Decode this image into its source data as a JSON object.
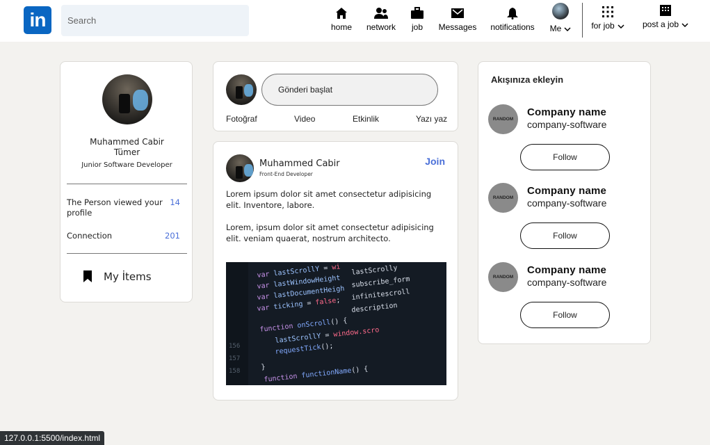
{
  "nav": {
    "logo_text": "in",
    "search_placeholder": "Search",
    "items": [
      {
        "label": "home",
        "icon": "home-icon"
      },
      {
        "label": "network",
        "icon": "people-icon"
      },
      {
        "label": "job",
        "icon": "briefcase-icon"
      },
      {
        "label": "Messages",
        "icon": "message-icon"
      },
      {
        "label": "notifications",
        "icon": "bell-icon"
      },
      {
        "label": "Me",
        "icon": "avatar"
      },
      {
        "label": "for job",
        "icon": "grid-icon"
      },
      {
        "label": "post a job",
        "icon": "building-icon"
      }
    ],
    "brand_color": "#0a66c2"
  },
  "profile": {
    "name_line1": "Muhammed Cabir",
    "name_line2": "Tümer",
    "title": "Junior Software Developer",
    "stats": [
      {
        "label": "The Person viewed your profile",
        "value": "14"
      },
      {
        "label": "Connection",
        "value": "201"
      }
    ],
    "my_items": "My İtems"
  },
  "composer": {
    "placeholder": "Gönderi başlat",
    "actions": [
      "Fotoğraf",
      "Video",
      "Etkinlik",
      "Yazı yaz"
    ]
  },
  "post": {
    "author": "Muhammed Cabir",
    "role": "Front-End Developer",
    "join": "Join",
    "paragraph1": "Lorem ipsum dolor sit amet consectetur adipisicing elit. Inventore, labore.",
    "paragraph2": "Lorem, ipsum dolor sit amet consectetur adipisicing elit. veniam quaerat, nostrum architecto.",
    "accent_color": "#4a6fd8"
  },
  "suggestions": {
    "title": "Akışınıza ekleyin",
    "items": [
      {
        "logo": "RANDOM",
        "name": "Company name",
        "sub": "company-software",
        "button": "Follow"
      },
      {
        "logo": "RANDOM",
        "name": "Company name",
        "sub": "company-software",
        "button": "Follow"
      },
      {
        "logo": "RANDOM",
        "name": "Company name",
        "sub": "company-software",
        "button": "Follow"
      }
    ]
  },
  "status_url": "127.0.0.1:5500/index.html"
}
